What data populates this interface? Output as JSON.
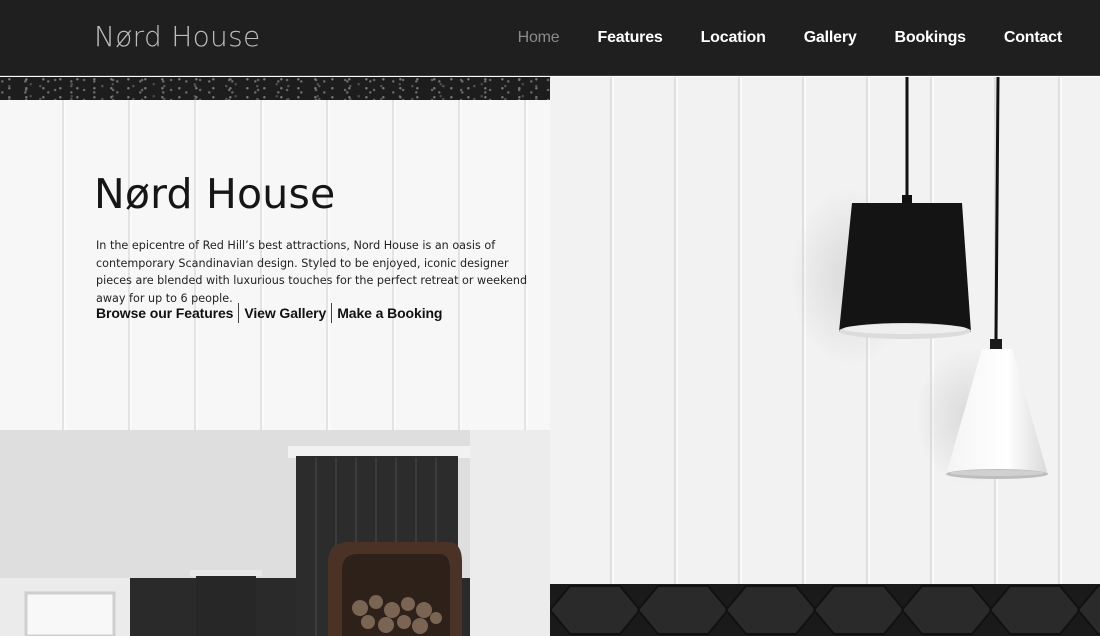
{
  "header": {
    "brand": "Nørd House",
    "nav": [
      {
        "label": "Home",
        "active": true
      },
      {
        "label": "Features",
        "active": false
      },
      {
        "label": "Location",
        "active": false
      },
      {
        "label": "Gallery",
        "active": false
      },
      {
        "label": "Bookings",
        "active": false
      },
      {
        "label": "Contact",
        "active": false
      }
    ]
  },
  "hero": {
    "title": "Nørd House",
    "description": "In the epicentre of Red Hill’s best attractions, Nord House is an oasis of contemporary Scandinavian design. Styled to be enjoyed, iconic designer pieces are blended with luxurious touches for the perfect retreat or weekend away for up to 6 people.",
    "links": [
      {
        "label": "Browse our Features"
      },
      {
        "label": "View Gallery"
      },
      {
        "label": "Make a Booking"
      }
    ]
  },
  "colors": {
    "header_bg": "#1f1f1f",
    "nav_active": "#8a8a8a",
    "nav_text": "#ffffff",
    "body_text": "#161616"
  }
}
